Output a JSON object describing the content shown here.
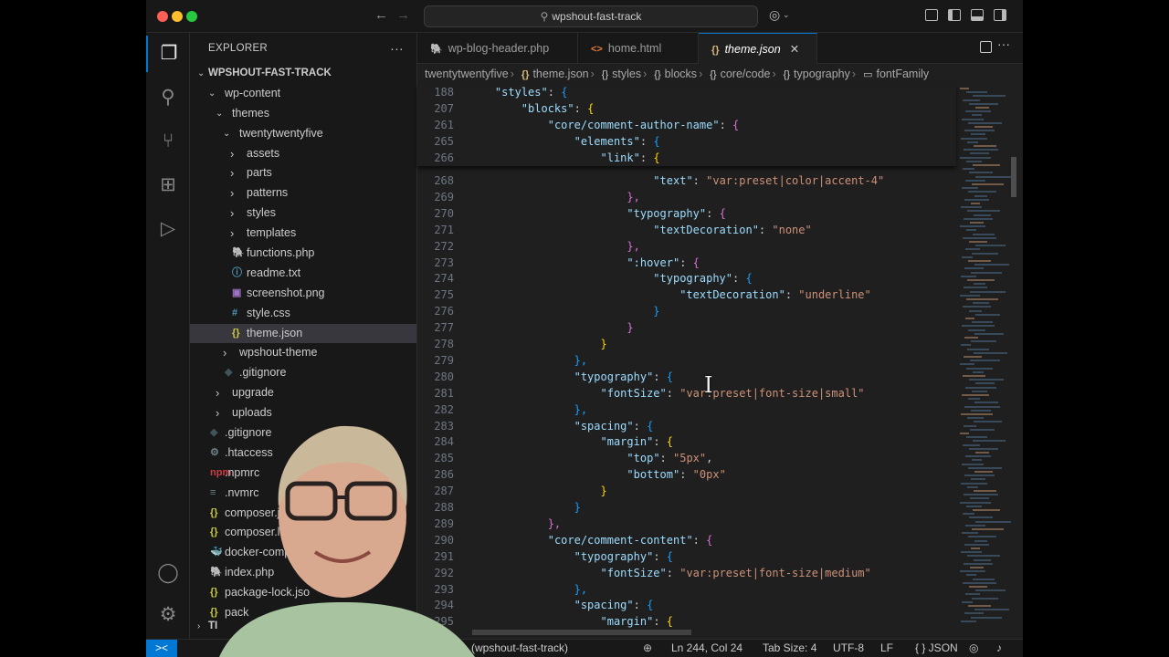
{
  "window": {
    "title": "wpshout-fast-track",
    "nav_back": "←",
    "nav_forward": "→",
    "copilot_icon": "copilot-icon",
    "layout_icons": [
      "sidebar-left-icon",
      "panel-icon",
      "sidebar-right-icon"
    ]
  },
  "activity_bar": [
    "explorer-icon",
    "search-icon",
    "source-control-icon",
    "extensions-icon",
    "run-debug-icon",
    "account-icon",
    "settings-icon"
  ],
  "explorer": {
    "header": "EXPLORER",
    "more": "···",
    "root": "WPSHOUT-FAST-TRACK",
    "items": [
      {
        "label": "wp-content",
        "level": 1,
        "twistie": "v"
      },
      {
        "label": "themes",
        "level": 2,
        "twistie": "v"
      },
      {
        "label": "twentytwentyfive",
        "level": 3,
        "twistie": "v"
      },
      {
        "label": "assets",
        "level": 4,
        "twistie": ">"
      },
      {
        "label": "parts",
        "level": 4,
        "twistie": ">"
      },
      {
        "label": "patterns",
        "level": 4,
        "twistie": ">"
      },
      {
        "label": "styles",
        "level": 4,
        "twistie": ">"
      },
      {
        "label": "templates",
        "level": 4,
        "twistie": ">"
      },
      {
        "label": "functions.php",
        "level": 4,
        "icon": "🐘"
      },
      {
        "label": "readme.txt",
        "level": 4,
        "icon": "ⓘ"
      },
      {
        "label": "screenshot.png",
        "level": 4,
        "icon": "▣"
      },
      {
        "label": "style.css",
        "level": 4,
        "icon": "#"
      },
      {
        "label": "theme.json",
        "level": 4,
        "icon": "{}",
        "selected": true
      },
      {
        "label": "wpshout-theme",
        "level": 3,
        "twistie": ">"
      },
      {
        "label": ".gitignore",
        "level": 3,
        "icon": "◆"
      },
      {
        "label": "upgrade",
        "level": 2,
        "twistie": ">"
      },
      {
        "label": "uploads",
        "level": 2,
        "twistie": ">"
      },
      {
        "label": ".gitignore",
        "level": 1,
        "icon": "◆"
      },
      {
        "label": ".htaccess",
        "level": 1,
        "icon": "⚙"
      },
      {
        "label": ".npmrc",
        "level": 1,
        "icon": "npm"
      },
      {
        "label": ".nvmrc",
        "level": 1,
        "icon": "≡"
      },
      {
        "label": "composer.js",
        "level": 1,
        "icon": "{}"
      },
      {
        "label": "composer.lo",
        "level": 1,
        "icon": "{}"
      },
      {
        "label": "docker-compo",
        "level": 1,
        "icon": "🐳"
      },
      {
        "label": "index.php",
        "level": 1,
        "icon": "🐘"
      },
      {
        "label": "package-lock.jso",
        "level": 1,
        "icon": "{}"
      },
      {
        "label": "pack",
        "level": 1,
        "icon": "{}"
      }
    ],
    "collapsed_section": "TI"
  },
  "tabs": [
    {
      "label": "wp-blog-header.php",
      "icon": "🐘",
      "active": false
    },
    {
      "label": "home.html",
      "icon": "<>",
      "active": false
    },
    {
      "label": "theme.json",
      "icon": "{}",
      "active": true,
      "close": "✕"
    }
  ],
  "breadcrumb": [
    "twentytwentyfive",
    "theme.json",
    "styles",
    "blocks",
    "core/code",
    "typography",
    "fontFamily"
  ],
  "sticky_lines": [
    {
      "n": "188",
      "indent": 1,
      "key": "styles",
      "open": "{"
    },
    {
      "n": "207",
      "indent": 2,
      "key": "blocks",
      "open": "{"
    },
    {
      "n": "261",
      "indent": 3,
      "key": "core/comment-author-name",
      "open": "{"
    },
    {
      "n": "265",
      "indent": 4,
      "key": "elements",
      "open": "{"
    },
    {
      "n": "266",
      "indent": 5,
      "key": "link",
      "open": "{"
    }
  ],
  "code_lines": [
    {
      "n": "268",
      "indent": 7,
      "key": "text",
      "value": "var:preset|color|accent-4"
    },
    {
      "n": "269",
      "indent": 6,
      "close": "},"
    },
    {
      "n": "270",
      "indent": 6,
      "key": "typography",
      "open": "{"
    },
    {
      "n": "271",
      "indent": 7,
      "key": "textDecoration",
      "value": "none"
    },
    {
      "n": "272",
      "indent": 6,
      "close": "},"
    },
    {
      "n": "273",
      "indent": 6,
      "key": ":hover",
      "open": "{"
    },
    {
      "n": "274",
      "indent": 7,
      "key": "typography",
      "open": "{"
    },
    {
      "n": "275",
      "indent": 8,
      "key": "textDecoration",
      "value": "underline"
    },
    {
      "n": "276",
      "indent": 7,
      "close": "}"
    },
    {
      "n": "277",
      "indent": 6,
      "close": "}"
    },
    {
      "n": "278",
      "indent": 5,
      "close": "}"
    },
    {
      "n": "279",
      "indent": 4,
      "close": "},"
    },
    {
      "n": "280",
      "indent": 4,
      "key": "typography",
      "open": "{"
    },
    {
      "n": "281",
      "indent": 5,
      "key": "fontSize",
      "value": "var:preset|font-size|small"
    },
    {
      "n": "282",
      "indent": 4,
      "close": "},"
    },
    {
      "n": "283",
      "indent": 4,
      "key": "spacing",
      "open": "{"
    },
    {
      "n": "284",
      "indent": 5,
      "key": "margin",
      "open": "{"
    },
    {
      "n": "285",
      "indent": 6,
      "key": "top",
      "value": "5px",
      "comma": true
    },
    {
      "n": "286",
      "indent": 6,
      "key": "bottom",
      "value": "0px"
    },
    {
      "n": "287",
      "indent": 5,
      "close": "}"
    },
    {
      "n": "288",
      "indent": 4,
      "close": "}"
    },
    {
      "n": "289",
      "indent": 3,
      "close": "},"
    },
    {
      "n": "290",
      "indent": 3,
      "key": "core/comment-content",
      "open": "{"
    },
    {
      "n": "291",
      "indent": 4,
      "key": "typography",
      "open": "{"
    },
    {
      "n": "292",
      "indent": 5,
      "key": "fontSize",
      "value": "var:preset|font-size|medium"
    },
    {
      "n": "293",
      "indent": 4,
      "close": "},"
    },
    {
      "n": "294",
      "indent": 4,
      "key": "spacing",
      "open": "{"
    },
    {
      "n": "295",
      "indent": 5,
      "key": "margin",
      "open": "{"
    }
  ],
  "status": {
    "remote_icon": "><",
    "branch": "(wpshout-fast-track)",
    "position": "Ln 244, Col 24",
    "tab_size": "Tab Size: 4",
    "encoding": "UTF-8",
    "eol": "LF",
    "language": "{ } JSON",
    "icons": [
      "zoom-icon",
      "copilot-icon",
      "bell-icon"
    ]
  },
  "colors": {
    "accent": "#0078d4",
    "json_key": "#9cdcfe",
    "json_string": "#ce9178"
  }
}
